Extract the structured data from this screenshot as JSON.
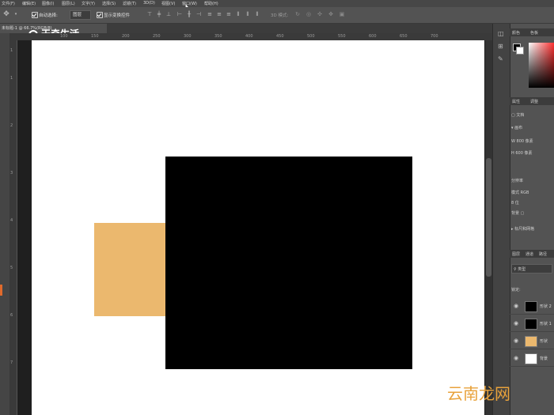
{
  "menubar": {
    "items": [
      "文件(F)",
      "编辑(E)",
      "图像(I)",
      "图层(L)",
      "文字(Y)",
      "选择(S)",
      "滤镜(T)",
      "3D(D)",
      "视图(V)",
      "窗口(W)",
      "帮助(H)"
    ]
  },
  "options": {
    "auto_select_label": "自动选择:",
    "auto_select_value": "图层",
    "show_transform_label": "显示变换控件",
    "mode_3d_label": "3D 模式:"
  },
  "document": {
    "tab_title": "未标题-1 @ 66.7%(RGB/8)",
    "watermark_text": "天奇生活"
  },
  "ruler": {
    "h_ticks": [
      "100",
      "150",
      "200",
      "250",
      "300",
      "350",
      "400",
      "450",
      "500",
      "550",
      "600",
      "650",
      "700"
    ],
    "v_ticks": [
      "1",
      "1",
      "2",
      "3",
      "4",
      "5",
      "6",
      "7"
    ]
  },
  "panels": {
    "color_tab": "颜色",
    "swatches_tab": "色板",
    "properties_tab": "属性",
    "adjustments_tab": "调整",
    "document_label": "文档",
    "canvas_label": "画布",
    "w_label": "W",
    "w_value": "800 像素",
    "h_label": "H",
    "h_value": "600 像素",
    "resolution_label": "分辨率",
    "mode_label": "模式",
    "mode_value": "RGB",
    "bit_value": "8 位",
    "bg_label": "背景",
    "guides_label": "标尺和网格",
    "layers_tab": "图层",
    "channels_tab": "通道",
    "paths_tab": "路径",
    "kind_label": "类型",
    "lock_label": "锁定:"
  },
  "layers": [
    {
      "name": "形状 2",
      "thumb_color": "#000000"
    },
    {
      "name": "形状 1",
      "thumb_color": "#000000"
    },
    {
      "name": "形状",
      "thumb_color": "#ebb86e"
    },
    {
      "name": "背景",
      "thumb_color": "#ffffff"
    }
  ],
  "colors": {
    "orange_shape": "#ebb86e",
    "black_shape": "#000000",
    "canvas": "#ffffff",
    "foreground": "#000000",
    "background": "#ffffff"
  },
  "footer_watermark": "云南龙网"
}
